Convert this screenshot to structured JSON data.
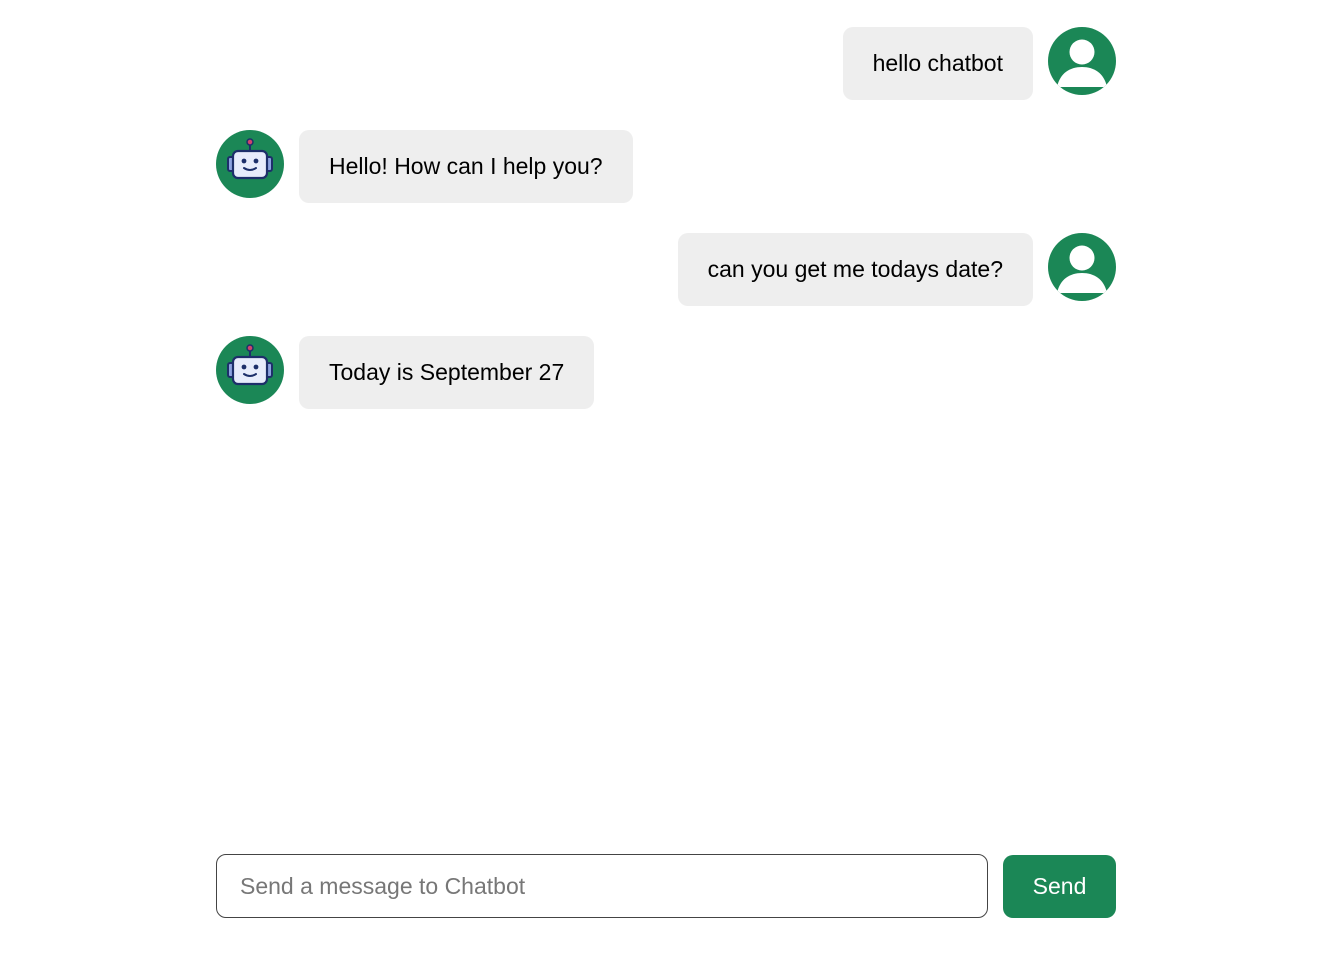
{
  "theme": {
    "accent": "#1b8756",
    "bubble_bg": "#eeeeee",
    "robot_face": "#e7ecfb",
    "robot_outline": "#1d2f6a",
    "robot_antenna_tip": "#d0436b"
  },
  "messages": [
    {
      "sender": "user",
      "avatar_icon": "user-icon",
      "text": "hello chatbot"
    },
    {
      "sender": "bot",
      "avatar_icon": "robot-icon",
      "text": "Hello! How can I help you?"
    },
    {
      "sender": "user",
      "avatar_icon": "user-icon",
      "text": "can you get me todays date?"
    },
    {
      "sender": "bot",
      "avatar_icon": "robot-icon",
      "text": "Today is September 27"
    }
  ],
  "composer": {
    "input_value": "",
    "input_placeholder": "Send a message to Chatbot",
    "send_label": "Send"
  }
}
